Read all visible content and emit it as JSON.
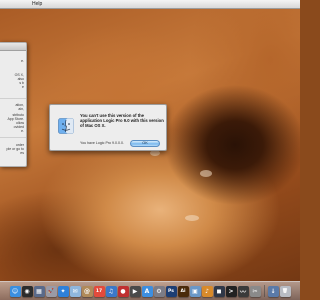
{
  "menubar": {
    "apple": "",
    "app_menu": "Help"
  },
  "background_window": {
    "lines": [
      "e.",
      "OS X,",
      "also",
      "s b",
      "e",
      "ation,",
      "ain,",
      "stributo",
      "App Store.",
      "ollow",
      "ovided",
      "e.",
      "order",
      "ple or go to",
      "es"
    ]
  },
  "dialog": {
    "message": "You can't use this version of the application Logic Pro 9.0 with this version of Mac OS X.",
    "info": "You have Logic Pro 9.0.0.0.",
    "ok_label": "OK",
    "icon": "finder-icon"
  },
  "dock": {
    "items": [
      {
        "name": "finder-icon",
        "glyph": "☺",
        "color": "#3a8fe0"
      },
      {
        "name": "dashboard-icon",
        "glyph": "◉",
        "color": "#2c2c2c"
      },
      {
        "name": "mission-control-icon",
        "glyph": "▦",
        "color": "#5a6a8a"
      },
      {
        "name": "launchpad-icon",
        "glyph": "🚀",
        "color": "#9a9aa6"
      },
      {
        "name": "safari-icon",
        "glyph": "✦",
        "color": "#2f80d9"
      },
      {
        "name": "mail-icon",
        "glyph": "✉",
        "color": "#8fb6dd"
      },
      {
        "name": "contacts-icon",
        "glyph": "@",
        "color": "#b08a5a"
      },
      {
        "name": "ical-icon",
        "glyph": "17",
        "color": "#e34a3c"
      },
      {
        "name": "itunes-icon",
        "glyph": "♫",
        "color": "#3c78c8"
      },
      {
        "name": "photo-booth-icon",
        "glyph": "●",
        "color": "#c03030"
      },
      {
        "name": "facetime-icon",
        "glyph": "▶",
        "color": "#4a4a4a"
      },
      {
        "name": "app-store-icon",
        "glyph": "A",
        "color": "#3d8ee0"
      },
      {
        "name": "system-preferences-icon",
        "glyph": "⚙",
        "color": "#7c7c86"
      },
      {
        "name": "photoshop-icon",
        "glyph": "Ps",
        "color": "#1d3e73"
      },
      {
        "name": "illustrator-icon",
        "glyph": "Ai",
        "color": "#4a2a0a"
      },
      {
        "name": "preview-icon",
        "glyph": "▣",
        "color": "#6a98c8"
      },
      {
        "name": "garageband-icon",
        "glyph": "♪",
        "color": "#d88a2a"
      },
      {
        "name": "logic-icon",
        "glyph": "◼",
        "color": "#303848"
      },
      {
        "name": "terminal-icon",
        "glyph": ">",
        "color": "#222222"
      },
      {
        "name": "activity-monitor-icon",
        "glyph": "〰",
        "color": "#3a3a3a"
      },
      {
        "name": "utility-icon",
        "glyph": "✂",
        "color": "#8a8a8a"
      }
    ],
    "trailing_items": [
      {
        "name": "downloads-stack-icon",
        "glyph": "↓",
        "color": "#5a7aa8"
      },
      {
        "name": "trash-icon",
        "glyph": "🗑",
        "color": "#b8bcc4"
      }
    ]
  }
}
